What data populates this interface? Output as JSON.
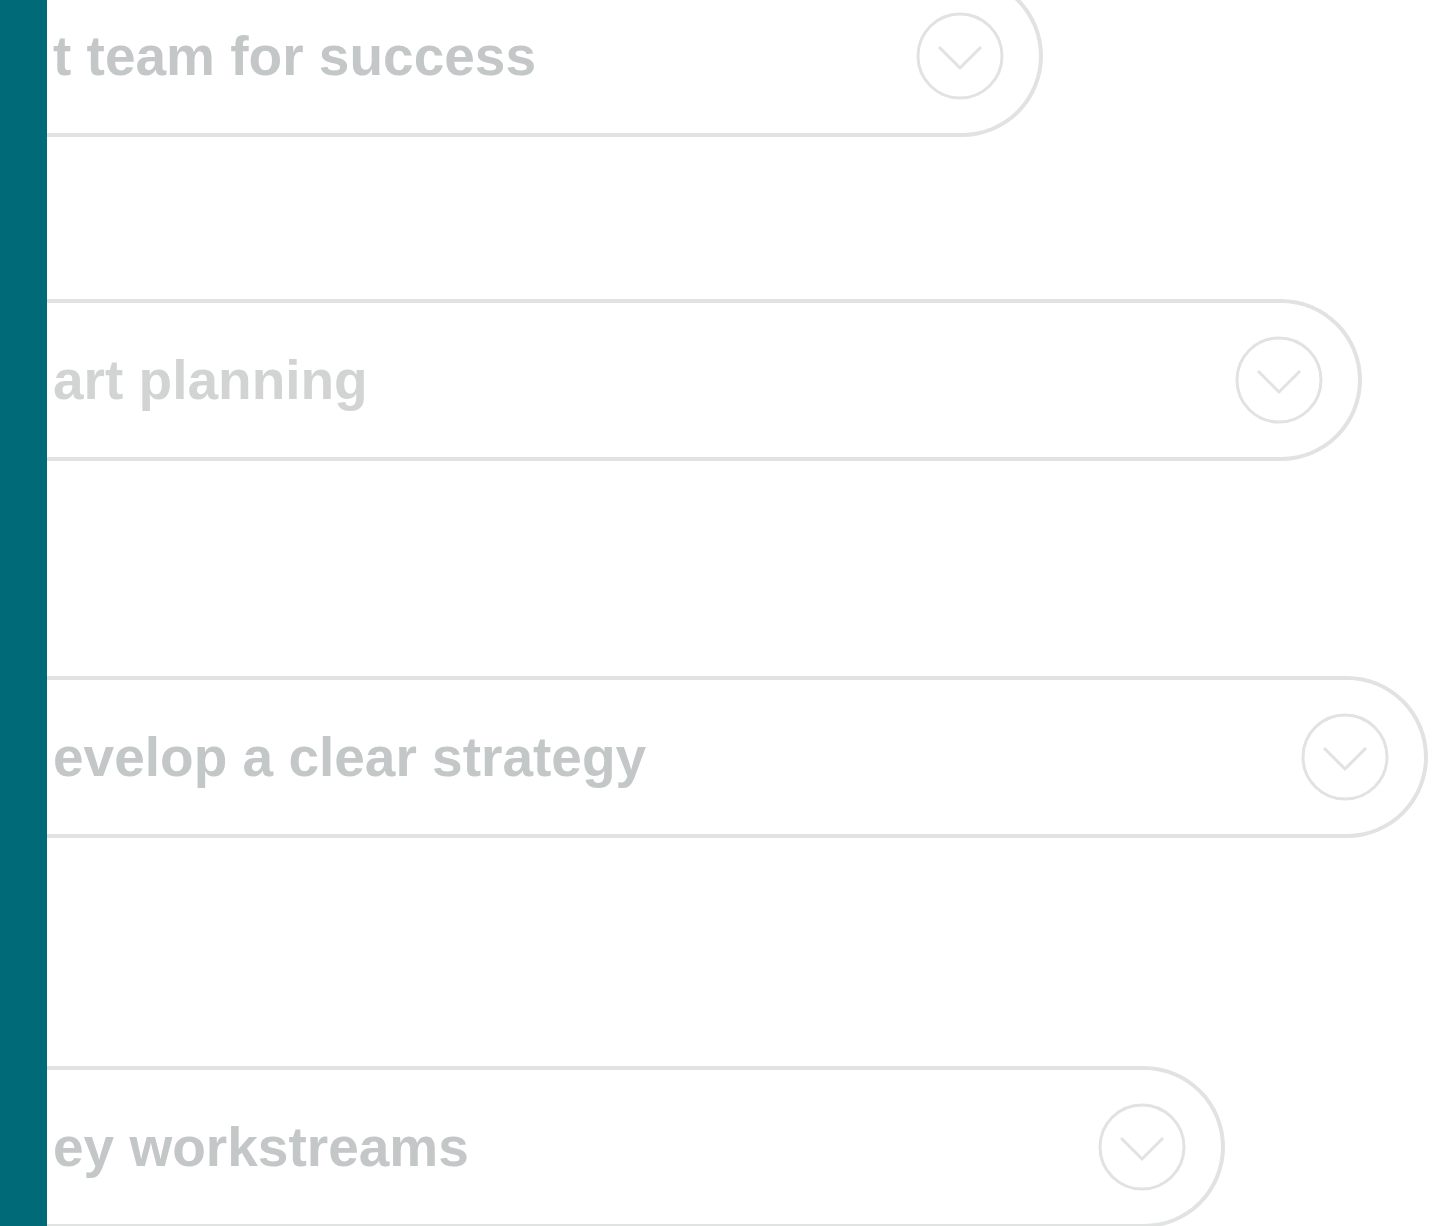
{
  "accordion": [
    {
      "title": "t team for success",
      "faded": false
    },
    {
      "title": "art planning",
      "faded": true
    },
    {
      "title": "evelop a clear strategy",
      "faded": false
    },
    {
      "title": "ey workstreams",
      "faded": false
    }
  ]
}
